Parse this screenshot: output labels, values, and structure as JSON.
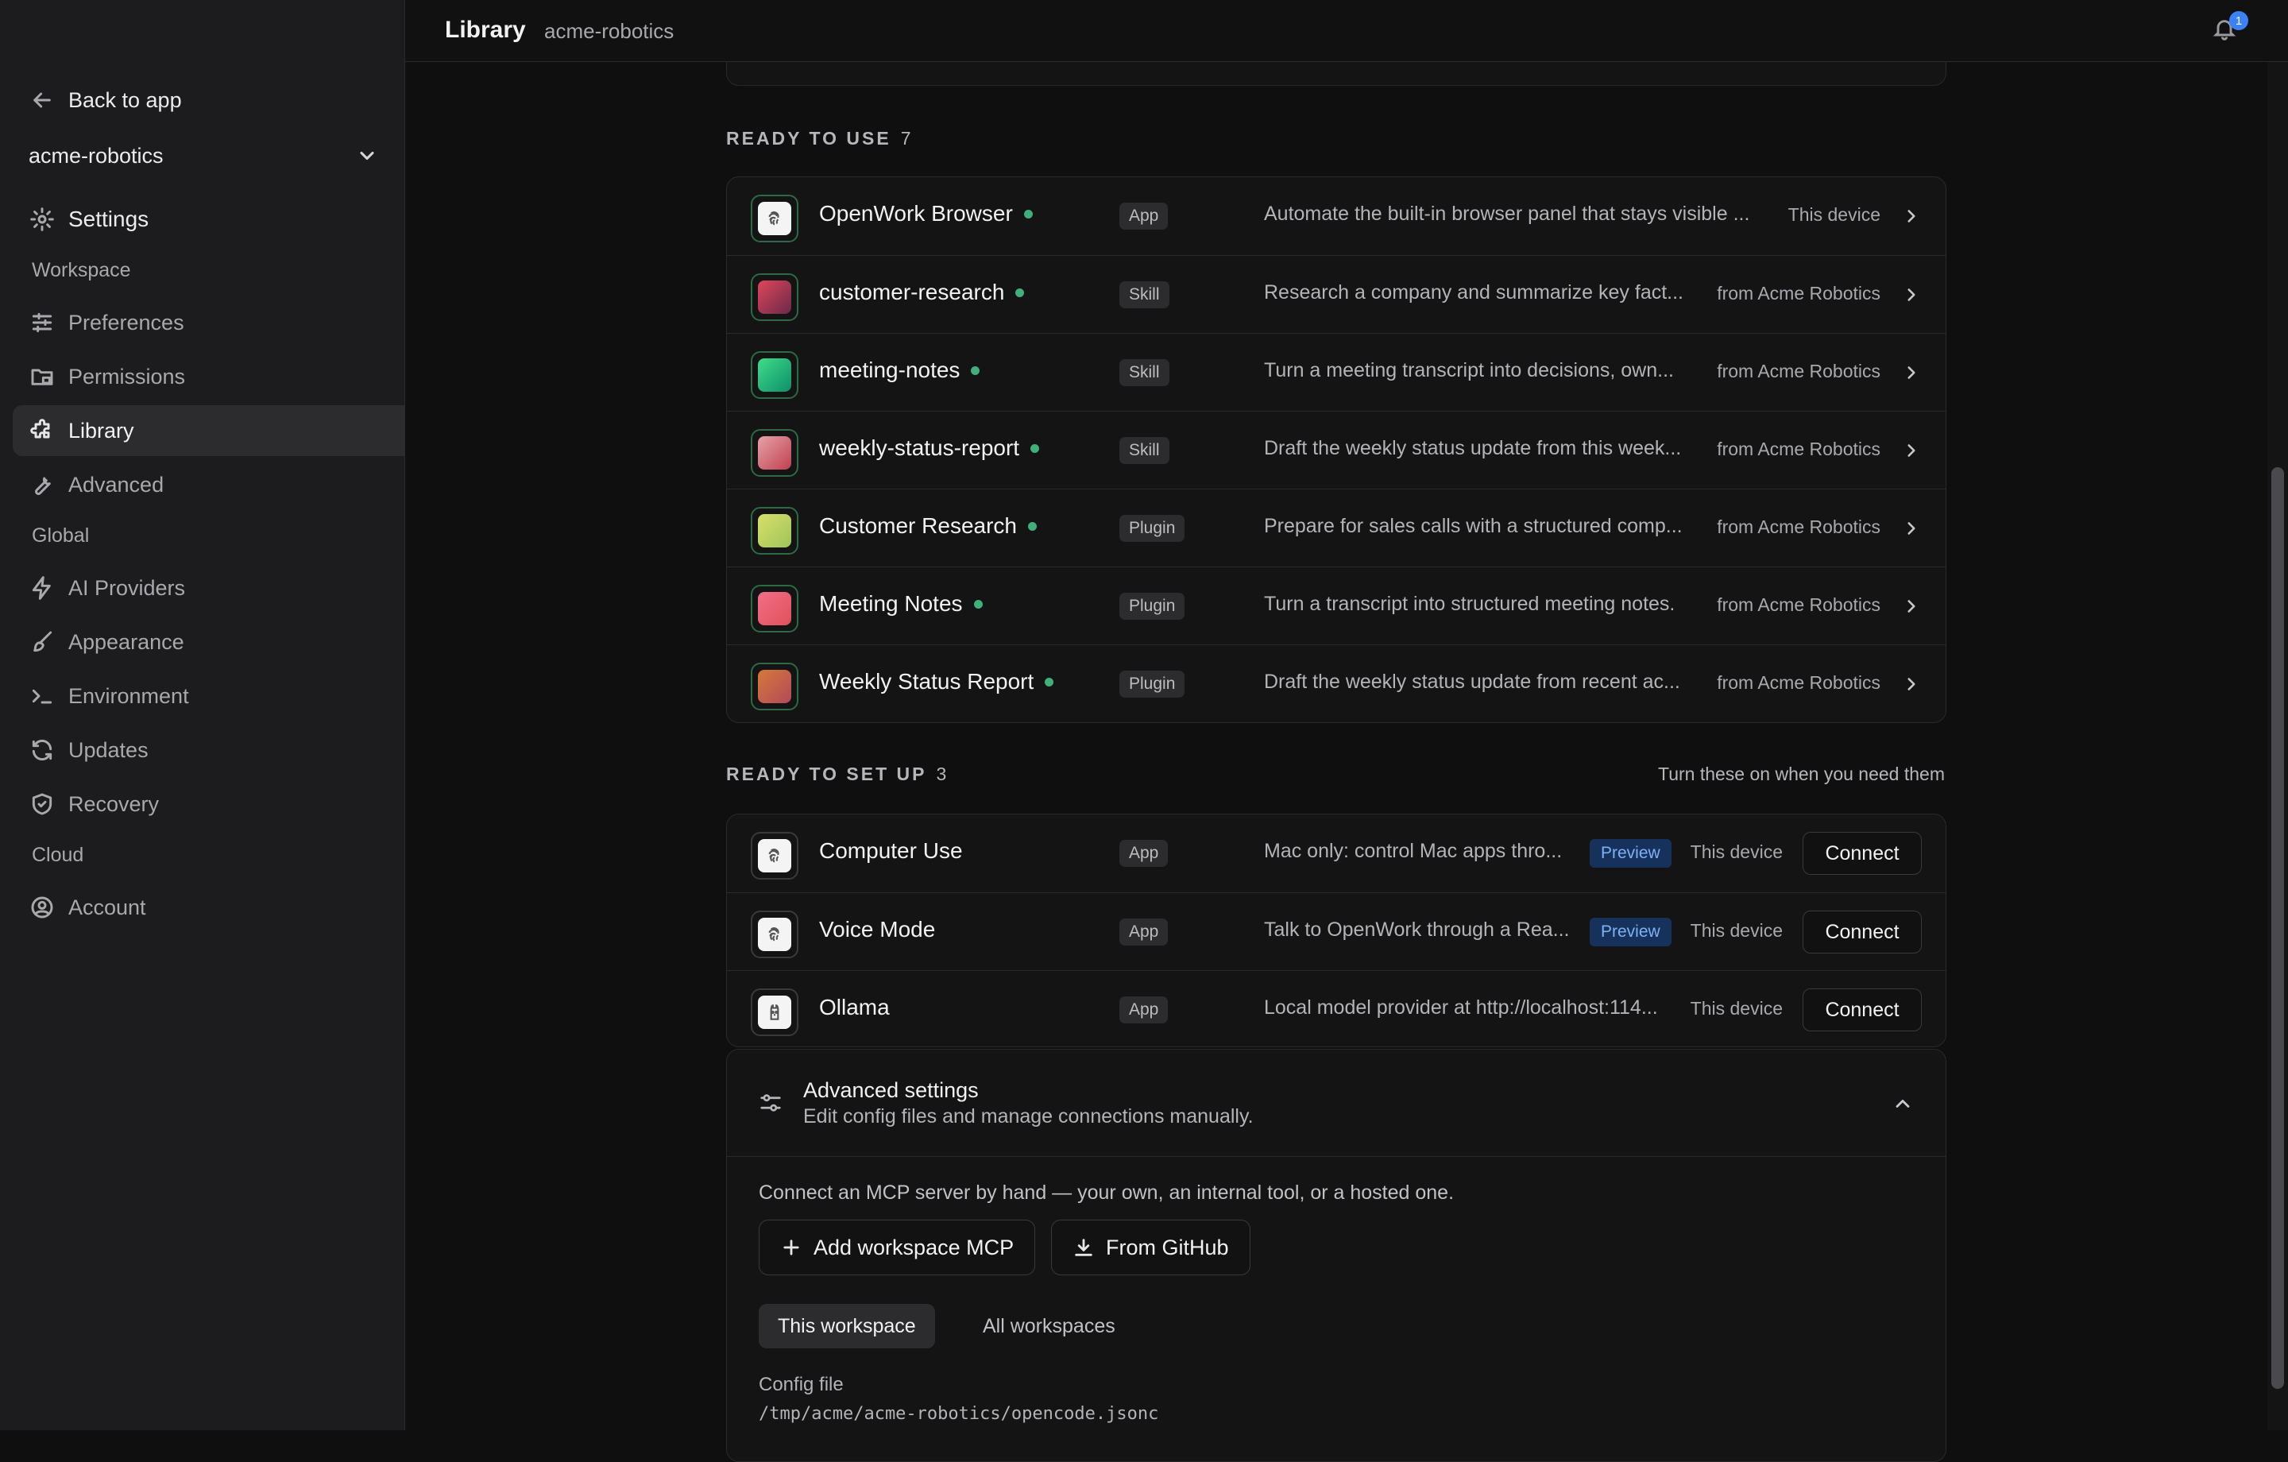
{
  "sidebar": {
    "back": "Back to app",
    "workspace": "acme-robotics",
    "settings": "Settings",
    "sections": {
      "workspace": "Workspace",
      "global": "Global",
      "cloud": "Cloud"
    },
    "items": {
      "preferences": "Preferences",
      "permissions": "Permissions",
      "library": "Library",
      "advanced": "Advanced",
      "ai_providers": "AI Providers",
      "appearance": "Appearance",
      "environment": "Environment",
      "updates": "Updates",
      "recovery": "Recovery",
      "account": "Account"
    }
  },
  "header": {
    "title": "Library",
    "subtitle": "acme-robotics",
    "notifications": "1"
  },
  "ready": {
    "heading": "READY TO USE",
    "count": "7",
    "rows": [
      {
        "name": "OpenWork Browser",
        "tag": "App",
        "desc": "Automate the built-in browser panel that stays visible ...",
        "meta": "This device",
        "icon": "openwork-icon"
      },
      {
        "name": "customer-research",
        "tag": "Skill",
        "desc": "Research a company and summarize key fact...",
        "meta": "from Acme Robotics",
        "icon": "gradient-red-icon"
      },
      {
        "name": "meeting-notes",
        "tag": "Skill",
        "desc": "Turn a meeting transcript into decisions, own...",
        "meta": "from Acme Robotics",
        "icon": "gradient-green-icon"
      },
      {
        "name": "weekly-status-report",
        "tag": "Skill",
        "desc": "Draft the weekly status update from this week...",
        "meta": "from Acme Robotics",
        "icon": "gradient-pink-icon"
      },
      {
        "name": "Customer Research",
        "tag": "Plugin",
        "desc": "Prepare for sales calls with a structured comp...",
        "meta": "from Acme Robotics",
        "icon": "gradient-yellow-icon"
      },
      {
        "name": "Meeting Notes",
        "tag": "Plugin",
        "desc": "Turn a transcript into structured meeting notes.",
        "meta": "from Acme Robotics",
        "icon": "gradient-rose-icon"
      },
      {
        "name": "Weekly Status Report",
        "tag": "Plugin",
        "desc": "Draft the weekly status update from recent ac...",
        "meta": "from Acme Robotics",
        "icon": "gradient-orange-icon"
      }
    ]
  },
  "setup": {
    "heading": "READY TO SET UP",
    "count": "3",
    "hint": "Turn these on when you need them",
    "rows": [
      {
        "name": "Computer Use",
        "tag": "App",
        "desc": "Mac only: control Mac apps thro...",
        "badge": "Preview",
        "meta": "This device",
        "action": "Connect",
        "icon": "openwork-icon"
      },
      {
        "name": "Voice Mode",
        "tag": "App",
        "desc": "Talk to OpenWork through a Rea...",
        "badge": "Preview",
        "meta": "This device",
        "action": "Connect",
        "icon": "openwork-icon"
      },
      {
        "name": "Ollama",
        "tag": "App",
        "desc": "Local model provider at http://localhost:114...",
        "meta": "This device",
        "action": "Connect",
        "icon": "ollama-icon"
      }
    ]
  },
  "advanced": {
    "title": "Advanced settings",
    "subtitle": "Edit config files and manage connections manually.",
    "intro": "Connect an MCP server by hand — your own, an internal tool, or a hosted one.",
    "add_button": "Add workspace MCP",
    "github_button": "From GitHub",
    "tabs": [
      "This workspace",
      "All workspaces"
    ],
    "config_label": "Config file",
    "config_path": "/tmp/acme/acme-robotics/opencode.jsonc"
  },
  "colors": {
    "accent": "#3b82f6",
    "status_dot": "#3fb07a",
    "preview_bg": "#16325c",
    "preview_text": "#7fb0f5"
  }
}
